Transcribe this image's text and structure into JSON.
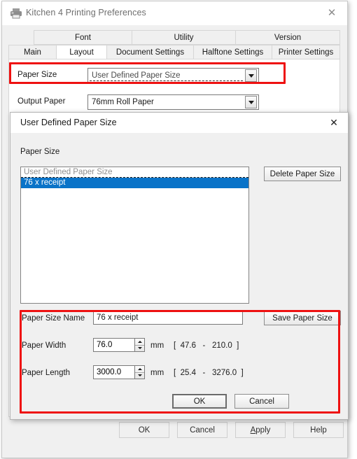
{
  "outer_window": {
    "title": "Kitchen 4 Printing Preferences",
    "icon": "printer-icon",
    "close_label": "✕"
  },
  "tabs": {
    "row1": [
      {
        "label": "",
        "spacer": true,
        "width": 36
      },
      {
        "label": "Font",
        "selected": false,
        "width": 140
      },
      {
        "label": "Utility",
        "selected": false,
        "width": 148
      },
      {
        "label": "Version",
        "selected": false,
        "width": 150
      }
    ],
    "row2": [
      {
        "label": "Main",
        "selected": false,
        "width": 68
      },
      {
        "label": "Layout",
        "selected": true,
        "width": 72
      },
      {
        "label": "Document Settings",
        "selected": false,
        "width": 124
      },
      {
        "label": "Halftone Settings",
        "selected": false,
        "width": 112
      },
      {
        "label": "Printer Settings",
        "selected": false,
        "width": 98
      }
    ]
  },
  "layout_panel": {
    "paper_size_label": "Paper Size",
    "paper_size_value": "User Defined Paper Size",
    "output_paper_label": "Output Paper",
    "output_paper_value": "76mm Roll Paper",
    "dropdown_icon": "chevron-down-icon"
  },
  "inner_dialog": {
    "title": "User Defined Paper Size",
    "close_label": "✕",
    "group_label": "Paper Size",
    "list": {
      "ghost_item": "User Defined Paper Size",
      "items": [
        {
          "label": "76 x receipt",
          "selected": true
        }
      ]
    },
    "delete_button": "Delete Paper Size",
    "save_button": "Save Paper Size",
    "name_label": "Paper Size Name",
    "name_value": "76 x receipt",
    "width_label": "Paper Width",
    "width_value": "76.0",
    "width_unit": "mm",
    "width_range": "[  47.6   -   210.0  ]",
    "length_label": "Paper Length",
    "length_value": "3000.0",
    "length_unit": "mm",
    "length_range": "[  25.4   -   3276.0  ]",
    "ok_button": "OK",
    "cancel_button": "Cancel"
  },
  "outer_buttons": {
    "ok": "OK",
    "cancel": "Cancel",
    "apply_accel": "A",
    "apply_rest": "pply",
    "help": "Help"
  },
  "highlights": {
    "color": "#ee1111"
  }
}
